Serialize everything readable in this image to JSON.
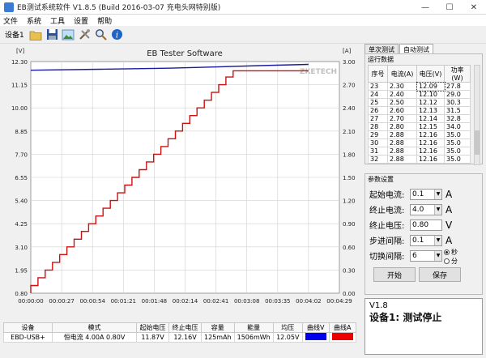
{
  "window": {
    "title": "EB测试系统软件 V1.8.5 (Build 2016-03-07 充电头网特别版)"
  },
  "menu": [
    "文件",
    "系统",
    "工具",
    "设置",
    "帮助"
  ],
  "toolbar": {
    "device_label": "设备1"
  },
  "chart_data": {
    "type": "line",
    "title": "EB Tester Software",
    "watermark": "ZKETECH",
    "left_unit": "[V]",
    "right_unit": "[A]",
    "y_left_ticks": [
      "12.30",
      "11.15",
      "10.00",
      "8.85",
      "7.70",
      "6.55",
      "5.40",
      "4.25",
      "3.10",
      "1.95",
      "0.80"
    ],
    "y_left_range": [
      0.8,
      12.3
    ],
    "y_right_ticks": [
      "3.00",
      "2.70",
      "2.40",
      "2.10",
      "1.80",
      "1.50",
      "1.20",
      "0.90",
      "0.60",
      "0.30",
      "0.00"
    ],
    "y_right_range": [
      0.0,
      3.0
    ],
    "x_ticks": [
      "00:00:00",
      "00:00:27",
      "00:00:54",
      "00:01:21",
      "00:01:48",
      "00:02:14",
      "00:02:41",
      "00:03:08",
      "00:03:35",
      "00:04:02",
      "00:04:29"
    ],
    "x_range_seconds": [
      0,
      269
    ],
    "series": [
      {
        "name": "",
        "axis": "left",
        "color": "#1a1a9c",
        "x": [
          0,
          60,
          120,
          160,
          200,
          242
        ],
        "y": [
          11.87,
          11.92,
          11.97,
          12.03,
          12.1,
          12.16
        ]
      },
      {
        "name": "",
        "axis": "right",
        "color": "#cc1111",
        "step_interval_seconds": 6.3,
        "start": 0.1,
        "step": 0.1,
        "max": 2.88,
        "hold_until_seconds": 242
      }
    ]
  },
  "tabs": [
    "单次测试",
    "自动测试"
  ],
  "run_data": {
    "title": "运行数据",
    "headers": [
      "序号",
      "电流(A)",
      "电压(V)",
      "功率(W)"
    ],
    "rows": [
      [
        "23",
        "2.30",
        "12.09",
        "27.8"
      ],
      [
        "24",
        "2.40",
        "12.10",
        "29.0"
      ],
      [
        "25",
        "2.50",
        "12.12",
        "30.3"
      ],
      [
        "26",
        "2.60",
        "12.13",
        "31.5"
      ],
      [
        "27",
        "2.70",
        "12.14",
        "32.8"
      ],
      [
        "28",
        "2.80",
        "12.15",
        "34.0"
      ],
      [
        "29",
        "2.88",
        "12.16",
        "35.0"
      ],
      [
        "30",
        "2.88",
        "12.16",
        "35.0"
      ],
      [
        "31",
        "2.88",
        "12.16",
        "35.0"
      ],
      [
        "32",
        "2.88",
        "12.16",
        "35.0"
      ]
    ]
  },
  "params": {
    "title": "参数设置",
    "start_current": {
      "label": "起始电流:",
      "value": "0.1",
      "unit": "A"
    },
    "end_current": {
      "label": "终止电流:",
      "value": "4.0",
      "unit": "A"
    },
    "end_voltage": {
      "label": "终止电压:",
      "value": "0.80",
      "unit": "V"
    },
    "step_interval": {
      "label": "步进间隔:",
      "value": "0.1",
      "unit": "A"
    },
    "switch_interval": {
      "label": "切换间隔:",
      "value": "6"
    },
    "radio_sec": "秒",
    "radio_min": "分",
    "start_button": "开始",
    "save_button": "保存"
  },
  "status": {
    "version": "V1.8",
    "message": "设备1: 测试停止"
  },
  "bottom_table": {
    "headers": [
      "设备",
      "模式",
      "起始电压",
      "终止电压",
      "容量",
      "能量",
      "均压",
      "曲线V",
      "曲线A"
    ],
    "row": [
      "EBD-USB+",
      "恒电流 4.00A 0.80V",
      "11.87V",
      "12.16V",
      "125mAh",
      "1506mWh",
      "12.05V"
    ],
    "curve_v_color": "#0000ee",
    "curve_a_color": "#ee0000"
  },
  "colors": {
    "voltage": "#1a1a9c",
    "current": "#cc1111",
    "grid": "#d0d0d0",
    "plot_bg": "#ffffff"
  }
}
